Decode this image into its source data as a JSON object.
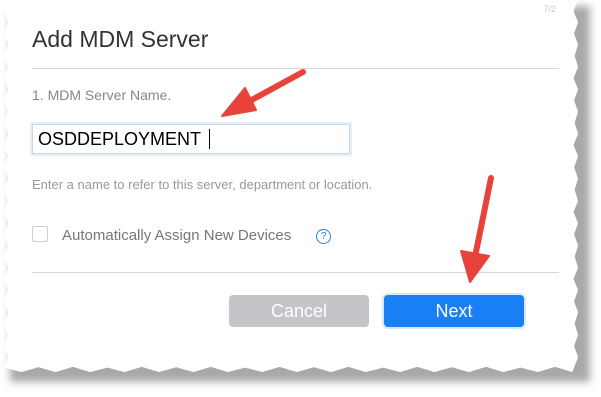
{
  "dialog": {
    "title": "Add MDM Server",
    "ghost_text": "7/2",
    "name_label": "1. MDM Server Name.",
    "name_value": "OSDDEPLOYMENT",
    "hint": "Enter a name to refer to this server, department or location.",
    "auto_assign_label": "Automatically Assign New Devices",
    "auto_assign_checked": false,
    "help_glyph": "?",
    "cancel_label": "Cancel",
    "next_label": "Next"
  },
  "annotations": {
    "arrow_color": "#e8433a",
    "arrow_icon": "red-arrow-icon"
  },
  "colors": {
    "primary": "#1a7ef4",
    "disabled": "#c3c5c9",
    "help": "#2a7de1"
  }
}
